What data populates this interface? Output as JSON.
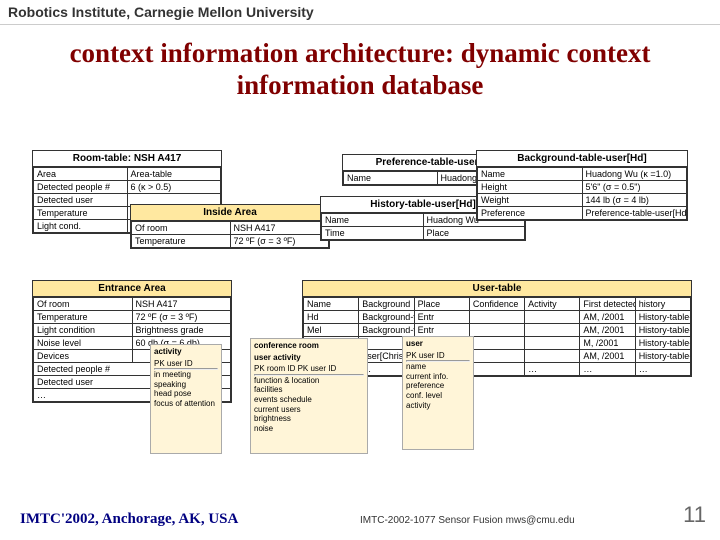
{
  "header": "Robotics Institute, Carnegie Mellon University",
  "title": "context information architecture: dynamic context information database",
  "room": {
    "title": "Room-table: NSH A417",
    "r0a": "Area",
    "r0b": "Area-table",
    "r1a": "Detected people #",
    "r1b": "6 (κ > 0.5)",
    "r2a": "Detected user",
    "r3a": "Temperature",
    "r4a": "Light cond."
  },
  "inside": {
    "title": "Inside Area",
    "r0a": "Of room",
    "r0b": "NSH A417",
    "r1a": "Temperature",
    "r1b": "72 ºF (σ = 3 ºF)"
  },
  "entrance": {
    "title": "Entrance Area",
    "r0a": "Of room",
    "r0b": "NSH A417",
    "r1a": "Temperature",
    "r1b": "72 ºF (σ = 3 ºF)",
    "r2a": "Light condition",
    "r2b": "Brightness grade",
    "r3a": "Noise level",
    "r3b": "60 db (σ = 6 db)",
    "r4a": "Devices",
    "r5a": "Detected people #",
    "r6a": "Detected user",
    "r7a": "…"
  },
  "pref": {
    "title": "Preference-table-user[Hd]",
    "r0a": "Name",
    "r0b": "Huadong"
  },
  "hist": {
    "title": "History-table-user[Hd]",
    "r0a": "Name",
    "r0b": "Huadong Wu",
    "r1a": "Time",
    "r1b": "Place"
  },
  "bg": {
    "title": "Background-table-user[Hd]",
    "r0a": "Name",
    "r0b": "Huadong Wu (κ =1.0)",
    "r1a": "Height",
    "r1b": "5'6\" (σ = 0.5\")",
    "r2a": "Weight",
    "r2b": "144 lb (σ = 4 lb)",
    "r3a": "Preference",
    "r3b": "Preference-table-user[Hd]"
  },
  "user": {
    "title": "User-table",
    "h0": "Name",
    "h1": "Background",
    "h2": "Place",
    "h3": "Confidence",
    "h4": "Activity",
    "h5": "First detected",
    "h6": "history",
    "r0_0": "Hd",
    "r0_1": "Background-table-user[Hd]",
    "r0_2": "Entr",
    "r0_5": "AM, /2001",
    "r0_6": "History-table-user[Hd]",
    "r1_0": "Mel",
    "r1_1": "Background-table-user[Mel]",
    "r1_2": "Entr",
    "r1_5": "AM, /2001",
    "r1_6": "History-table-user[Mel]",
    "r2_5": "M, /2001",
    "r2_6": "History-table-user[Alan]",
    "r3_1": "user[Chris]",
    "r3_5": "AM, /2001",
    "r3_6": "History-table-user[Chris]",
    "r4_0": "…",
    "r4_1": "…",
    "r4_4": "…",
    "r4_5": "…",
    "r4_6": "…"
  },
  "db_activity": {
    "h": "activity",
    "pk": "PK  user ID",
    "l1": "in meeting",
    "l2": "speaking",
    "l3": "head pose",
    "l4": "focus of attention"
  },
  "db_user": {
    "h": "user",
    "pk": "PK  user ID",
    "l1": "name",
    "l2": "current info.",
    "l3": "preference",
    "l4": "conf. level",
    "l5": "activity"
  },
  "db_ua": {
    "h": "user activity",
    "pk": "PK  room ID  PK  user ID",
    "l0": "conference room",
    "l1": "function & location",
    "l2": "facilities",
    "l3": "events schedule",
    "l4": "current users",
    "l5": "brightness",
    "l6": "noise"
  },
  "footer_left": "IMTC'2002, Anchorage, AK, USA",
  "footer_mid": "IMTC-2002-1077 Sensor Fusion mws@cmu.edu",
  "footer_page": "11"
}
